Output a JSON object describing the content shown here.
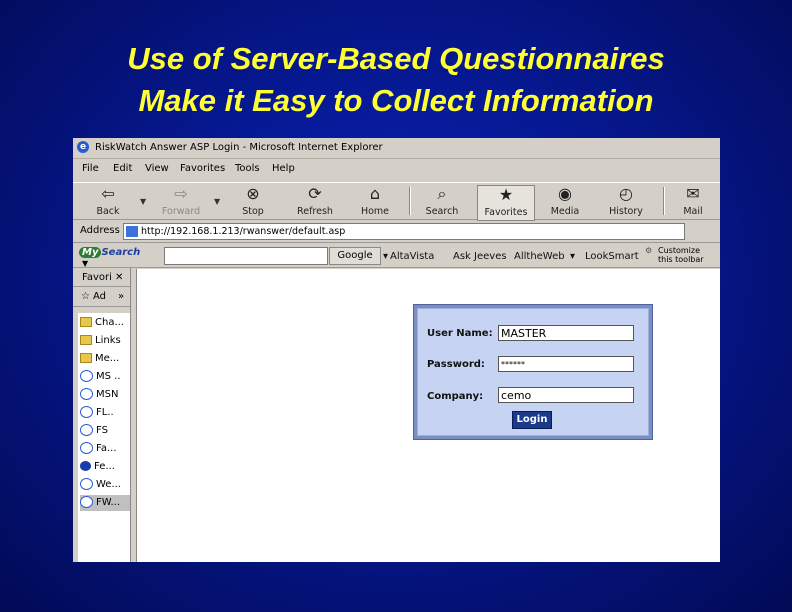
{
  "slide": {
    "title_line1": "Use of Server-Based Questionnaires",
    "title_line2": "Make it Easy to Collect Information"
  },
  "window": {
    "title": "RiskWatch Answer ASP Login - Microsoft Internet Explorer"
  },
  "menu": [
    "File",
    "Edit",
    "View",
    "Favorites",
    "Tools",
    "Help"
  ],
  "toolbar": {
    "back": "Back",
    "forward": "Forward",
    "stop": "Stop",
    "refresh": "Refresh",
    "home": "Home",
    "search": "Search",
    "favorites": "Favorites",
    "media": "Media",
    "history": "History",
    "mail": "Mail"
  },
  "address": {
    "label": "Address",
    "url": "http://192.168.1.213/rwanswer/default.asp"
  },
  "searchbar": {
    "brand_my": "My",
    "brand_search": "Search",
    "google": "Google",
    "links": [
      "AltaVista",
      "Ask Jeeves",
      "AlltheWeb",
      "LookSmart"
    ],
    "customize_line1": "Customize",
    "customize_line2": "this toolbar"
  },
  "sidebar": {
    "header": "Favori",
    "add_label": "Ad",
    "items": [
      {
        "label": "Cha...",
        "icon": "folder-icon"
      },
      {
        "label": "Links",
        "icon": "folder-icon"
      },
      {
        "label": "Me...",
        "icon": "folder-icon"
      },
      {
        "label": "MS ..",
        "icon": "ie-page-icon"
      },
      {
        "label": "MSN",
        "icon": "ie-page-icon"
      },
      {
        "label": "FL..",
        "icon": "ie-page-icon"
      },
      {
        "label": "FS",
        "icon": "ie-page-icon"
      },
      {
        "label": "Fa...",
        "icon": "ie-page-icon"
      },
      {
        "label": "Fe...",
        "icon": "feed-icon"
      },
      {
        "label": "We...",
        "icon": "ie-page-icon"
      },
      {
        "label": "FW...",
        "icon": "ie-page-icon"
      }
    ]
  },
  "login": {
    "username_label": "User Name:",
    "username_value": "MASTER",
    "password_label": "Password:",
    "password_value": "******",
    "company_label": "Company:",
    "company_value": "cemo",
    "button": "Login"
  }
}
